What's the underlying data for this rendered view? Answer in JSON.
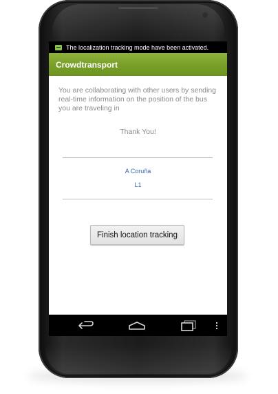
{
  "status_bar": {
    "notification_icon": "notification-icon",
    "text": "The localization tracking mode have been activated."
  },
  "action_bar": {
    "title": "Crowdtransport",
    "color": "#7aa02a"
  },
  "content": {
    "message": "You are collaborating with other users by sending real-time information on the position of the bus you are traveling in",
    "thanks": "Thank You!",
    "city": "A Coruña",
    "line": "L1",
    "finish_button_label": "Finish location tracking",
    "link_color": "#3a63b0"
  },
  "nav_bar": {
    "icons": [
      "back-icon",
      "home-icon",
      "recent-apps-icon",
      "menu-icon"
    ]
  }
}
